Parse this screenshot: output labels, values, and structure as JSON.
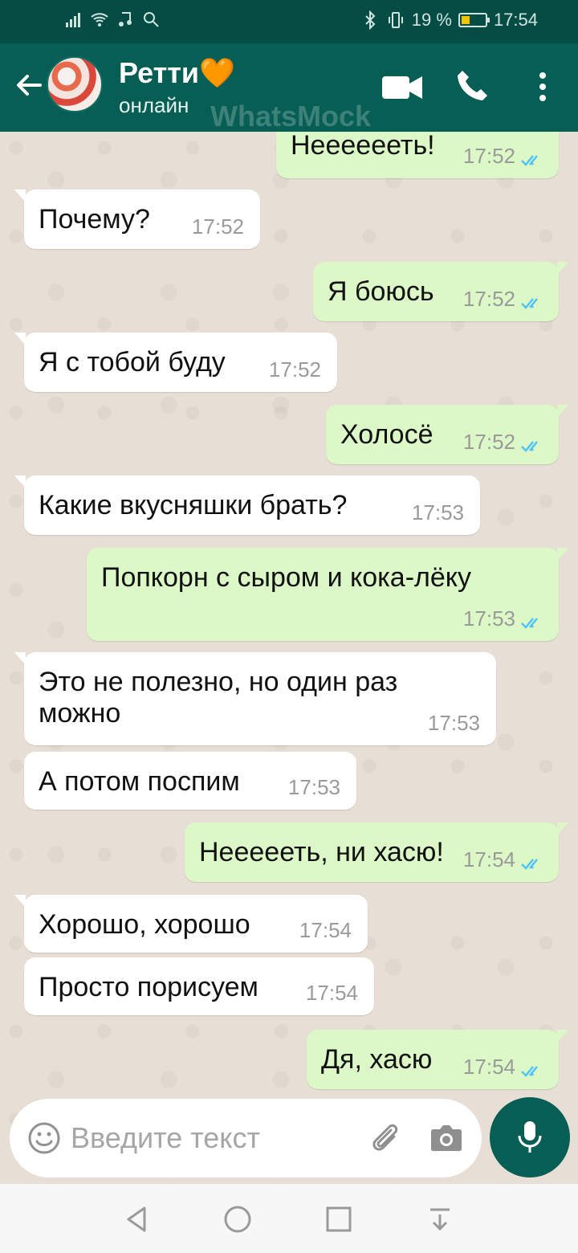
{
  "status_bar": {
    "battery": "19 %",
    "time": "17:54"
  },
  "header": {
    "name": "Ретти🧡",
    "status": "онлайн",
    "watermark": "WhatsMock"
  },
  "messages": [
    {
      "dir": "out",
      "text": "Нееееееть!",
      "time": "17:52"
    },
    {
      "dir": "in",
      "text": "Почему?",
      "time": "17:52"
    },
    {
      "dir": "out",
      "text": "Я боюсь",
      "time": "17:52"
    },
    {
      "dir": "in",
      "text": "Я с тобой буду",
      "time": "17:52"
    },
    {
      "dir": "out",
      "text": "Холосё",
      "time": "17:52"
    },
    {
      "dir": "in",
      "text": "Какие вкусняшки брать?",
      "time": "17:53"
    },
    {
      "dir": "out",
      "text": "Попкорн с сыром и кока-лёку",
      "time": "17:53"
    },
    {
      "dir": "in",
      "text": "Это не полезно, но один раз можно",
      "time": "17:53"
    },
    {
      "dir": "in",
      "text": "А потом поспим",
      "time": "17:53"
    },
    {
      "dir": "out",
      "text": "Неееееть, ни хасю!",
      "time": "17:54"
    },
    {
      "dir": "in",
      "text": "Хорошо, хорошо",
      "time": "17:54"
    },
    {
      "dir": "in",
      "text": "Просто порисуем",
      "time": "17:54"
    },
    {
      "dir": "out",
      "text": "Дя, хасю",
      "time": "17:54"
    }
  ],
  "input": {
    "placeholder": "Введите текст"
  },
  "colors": {
    "header": "#075e54",
    "statusbar": "#054d44",
    "outgoing_bubble": "#dcf8c6",
    "incoming_bubble": "#ffffff",
    "read_ticks": "#4fc3f7"
  }
}
